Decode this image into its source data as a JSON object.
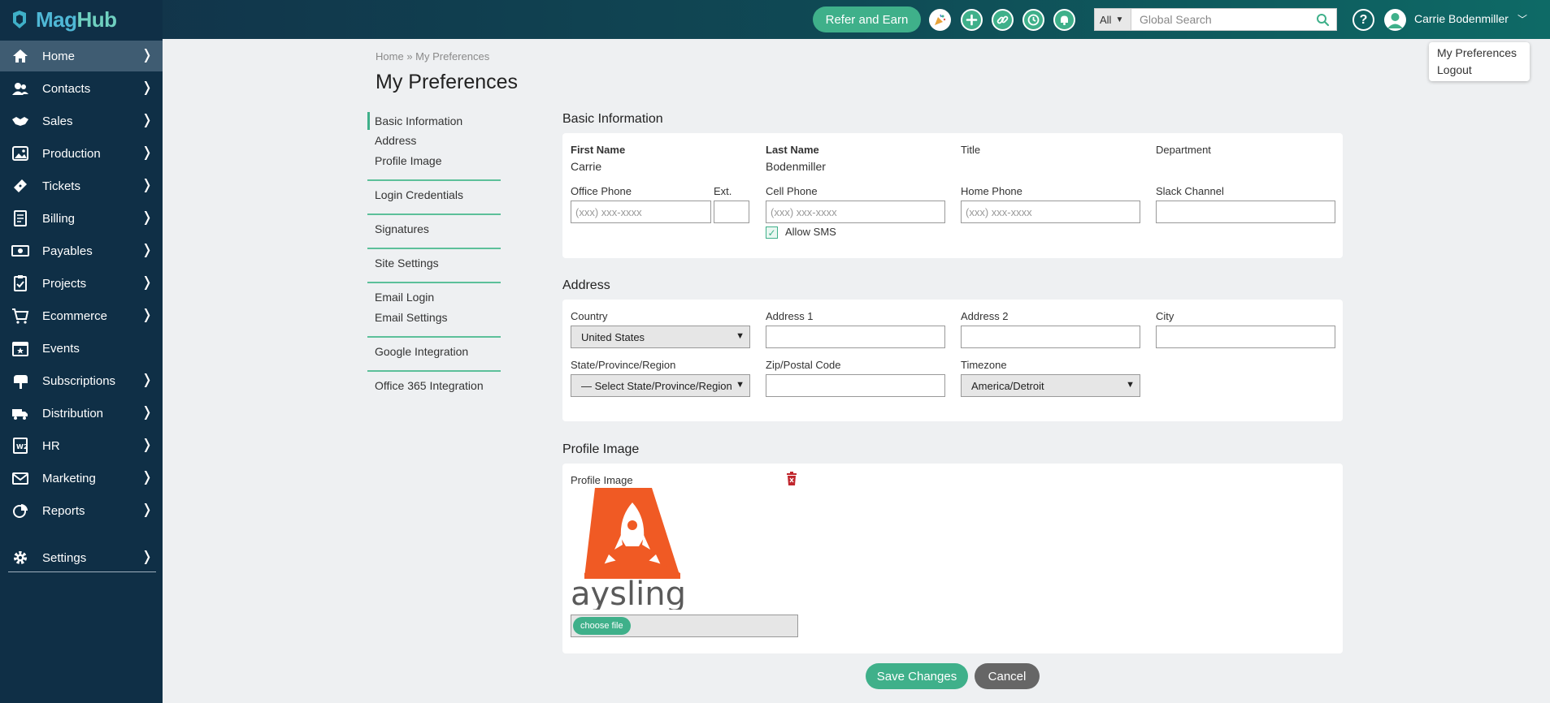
{
  "app": {
    "logo_mag": "Mag",
    "logo_hub": "Hub"
  },
  "header": {
    "refer_label": "Refer and Earn",
    "search_scope": "All",
    "search_placeholder": "Global Search",
    "help_label": "?",
    "user_name": "Carrie Bodenmiller"
  },
  "user_menu": {
    "items": [
      "My Preferences",
      "Logout"
    ]
  },
  "sidebar": {
    "items": [
      {
        "label": "Home",
        "icon": "home-icon",
        "arrow": "❭"
      },
      {
        "label": "Contacts",
        "icon": "contacts-icon",
        "arrow": "❭"
      },
      {
        "label": "Sales",
        "icon": "handshake-icon",
        "arrow": "❭"
      },
      {
        "label": "Production",
        "icon": "image-icon",
        "arrow": "❭"
      },
      {
        "label": "Tickets",
        "icon": "ticket-icon",
        "arrow": "❭"
      },
      {
        "label": "Billing",
        "icon": "invoice-icon",
        "arrow": "❭"
      },
      {
        "label": "Payables",
        "icon": "money-icon",
        "arrow": "❭"
      },
      {
        "label": "Projects",
        "icon": "clipboard-icon",
        "arrow": "❭"
      },
      {
        "label": "Ecommerce",
        "icon": "cart-icon",
        "arrow": "❭"
      },
      {
        "label": "Events",
        "icon": "calendar-icon",
        "arrow": ""
      },
      {
        "label": "Subscriptions",
        "icon": "mailbox-icon",
        "arrow": "❭"
      },
      {
        "label": "Distribution",
        "icon": "truck-icon",
        "arrow": "❭"
      },
      {
        "label": "HR",
        "icon": "w2-form-icon",
        "arrow": "❭"
      },
      {
        "label": "Marketing",
        "icon": "envelope-icon",
        "arrow": "❭"
      },
      {
        "label": "Reports",
        "icon": "chart-pie-icon",
        "arrow": "❭"
      }
    ],
    "settings": {
      "label": "Settings",
      "icon": "gear-icon",
      "arrow": "❭"
    }
  },
  "breadcrumb": {
    "home": "Home",
    "sep": "»",
    "current": "My Preferences"
  },
  "page_title": "My Preferences",
  "subnav": {
    "basic": "Basic Information",
    "address": "Address",
    "profile": "Profile Image",
    "login": "Login Credentials",
    "signatures": "Signatures",
    "site": "Site Settings",
    "email_login": "Email Login",
    "email_settings": "Email Settings",
    "google": "Google Integration",
    "office": "Office 365 Integration"
  },
  "basic": {
    "title": "Basic Information",
    "first_name_label": "First Name",
    "first_name": "Carrie",
    "last_name_label": "Last Name",
    "last_name": "Bodenmiller",
    "title_label": "Title",
    "department_label": "Department",
    "office_phone_label": "Office Phone",
    "office_phone_placeholder": "(xxx) xxx-xxxx",
    "ext_label": "Ext.",
    "cell_phone_label": "Cell Phone",
    "cell_phone_placeholder": "(xxx) xxx-xxxx",
    "allow_sms": "Allow SMS",
    "home_phone_label": "Home Phone",
    "home_phone_placeholder": "(xxx) xxx-xxxx",
    "slack_label": "Slack Channel"
  },
  "address": {
    "title": "Address",
    "country_label": "Country",
    "country": "United States",
    "address1_label": "Address 1",
    "address2_label": "Address 2",
    "city_label": "City",
    "state_label": "State/Province/Region",
    "state": "— Select State/Province/Region —",
    "zip_label": "Zip/Postal Code",
    "timezone_label": "Timezone",
    "timezone": "America/Detroit"
  },
  "profile": {
    "title": "Profile Image",
    "image_label": "Profile Image",
    "logo_text": "aysling",
    "choose_file": "choose file"
  },
  "actions": {
    "save": "Save Changes",
    "cancel": "Cancel"
  },
  "colors": {
    "accent": "#3fb08a",
    "sidebar": "#0f2f46",
    "logo_orange": "#f05a24"
  }
}
